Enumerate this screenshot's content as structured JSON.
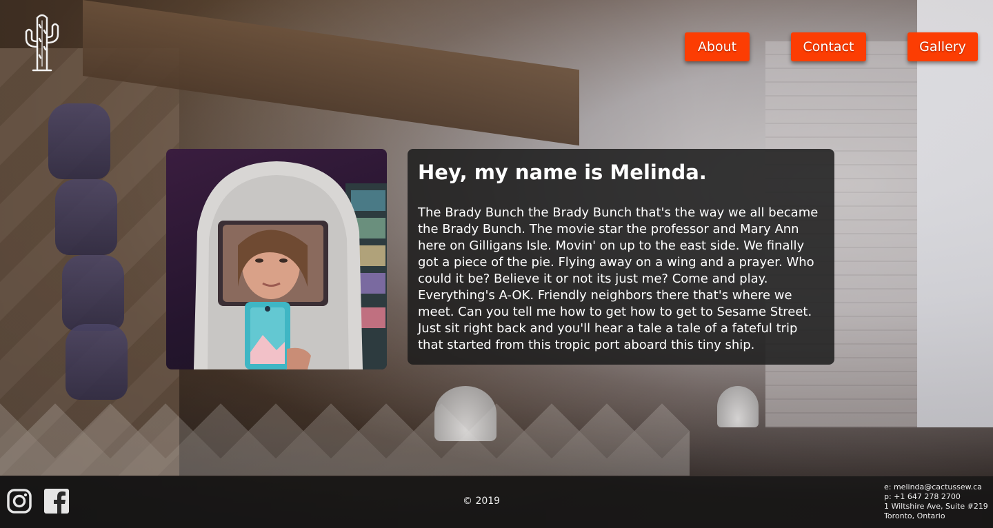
{
  "nav": {
    "about": "About",
    "contact": "Contact",
    "gallery": "Gallery"
  },
  "logo": {
    "icon": "cactus-icon"
  },
  "content": {
    "heading": "Hey, my name is Melinda.",
    "body": "The Brady Bunch the Brady Bunch that's the way we all became the Brady Bunch. The movie star the professor and Mary Ann here on Gilligans Isle. Movin' on up to the east side. We finally got a piece of the pie. Flying away on a wing and a prayer. Who could it be? Believe it or not its just me? Come and play. Everything's A-OK. Friendly neighbors there that's where we meet. Can you tell me how to get how to get to Sesame Street. Just sit right back and you'll hear a tale a tale of a fateful trip that started from this tropic port aboard this tiny ship."
  },
  "footer": {
    "copyright": "© 2019",
    "email": "e: melinda@cactussew.ca",
    "phone": "p: +1 647 278 2700",
    "address1": "1 Wiltshire Ave, Suite #219",
    "address2": "Toronto, Ontario",
    "social": [
      "instagram-icon",
      "facebook-icon"
    ]
  },
  "colors": {
    "accent": "#fc3d03",
    "panel": "#1c1c1c",
    "footer": "#141414"
  }
}
